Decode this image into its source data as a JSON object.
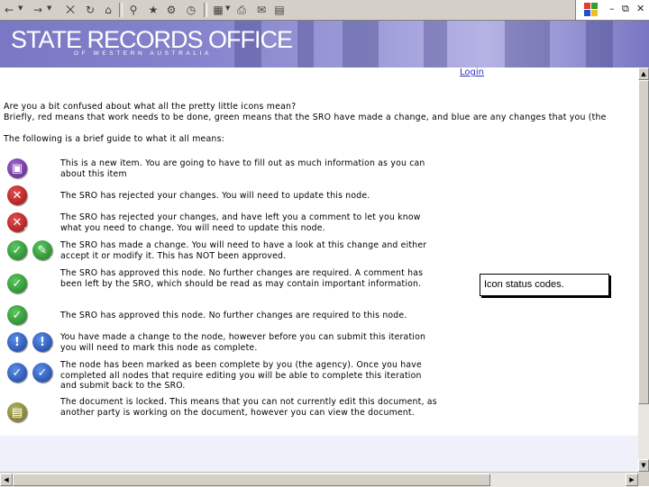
{
  "banner": {
    "title": "STATE RECORDS OFFICE",
    "subtitle": "OF WESTERN AUSTRALIA"
  },
  "login_link": "Login",
  "intro": {
    "line1": "Are you a bit confused about what all the pretty little icons mean?",
    "line2": "Briefly, red means that work needs to be done, green means that the SRO have made a change, and blue are any changes that you (the",
    "line3": "The following is a brief guide to what it all means:"
  },
  "legend": [
    {
      "icons": [
        "new-item-icon"
      ],
      "text": "This is a new item. You are going to have to fill out as much information as you can about this item"
    },
    {
      "icons": [
        "rejected-icon"
      ],
      "text": "The SRO has rejected your changes. You will need to update this node."
    },
    {
      "icons": [
        "rejected-with-comment-icon"
      ],
      "text": "The SRO has rejected your changes, and have left you a comment to let you know what you need to change. You will need to update this node."
    },
    {
      "icons": [
        "sro-changed-icon",
        "sro-changed-comment-icon"
      ],
      "text": "The SRO has made a change. You will need to have a look at this change and either accept it or modify it. This has NOT been approved."
    },
    {
      "icons": [
        "approved-with-comment-icon"
      ],
      "text": "The SRO has approved this node. No further changes are required. A comment has been left by the SRO, which should be read as may contain important information."
    },
    {
      "icons": [
        "approved-icon"
      ],
      "text": "The SRO has approved this node. No further changes are required to this node."
    },
    {
      "icons": [
        "agency-changed-icon",
        "agency-changed-comment-icon"
      ],
      "text": "You have made a change to the node, however before you can submit this iteration you will need to mark this node as complete."
    },
    {
      "icons": [
        "agency-complete-icon",
        "agency-complete-comment-icon"
      ],
      "text": "The node has been marked as been complete by you (the agency). Once you have completed all nodes that require editing you will be able to complete this iteration and submit back to the SRO."
    },
    {
      "icons": [
        "locked-icon"
      ],
      "text": "The document is locked. This means that you can not currently edit this document, as another party is working on the document, however you can view the document."
    }
  ],
  "tooltip": "Icon status codes.",
  "colors": {
    "banner": "#8583cc",
    "link": "#3030c0",
    "red": "#c02020",
    "green": "#2e9a34",
    "blue": "#2a5ac0",
    "purple": "#7a3aae"
  }
}
